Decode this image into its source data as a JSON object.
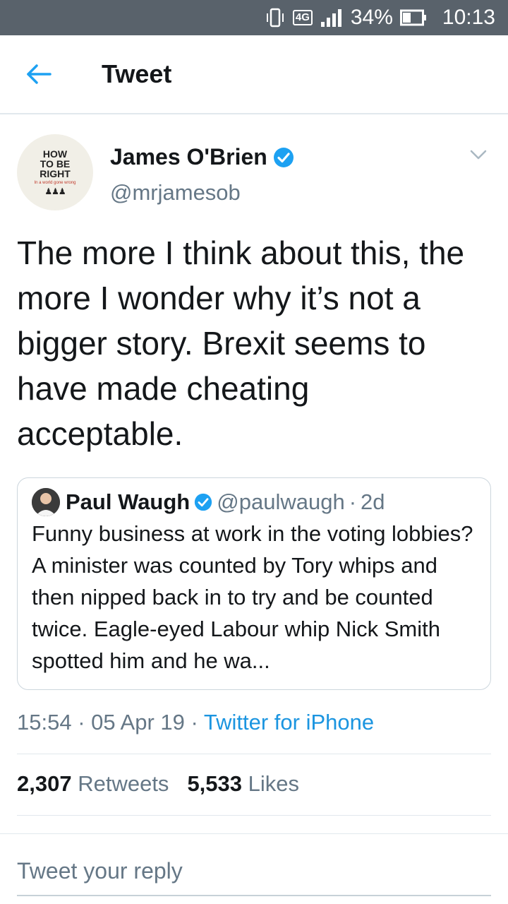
{
  "status_bar": {
    "network": "4G",
    "battery": "34%",
    "time": "10:13"
  },
  "header": {
    "title": "Tweet",
    "back_icon": "arrow-left-icon"
  },
  "tweet": {
    "avatar_text": [
      "HOW",
      "TO BE",
      "RIGHT",
      "In a world gone wrong"
    ],
    "display_name": "James O'Brien",
    "handle": "@mrjamesob",
    "text": "The more I think about this, the more I wonder why it’s not a bigger story. Brexit seems to have made cheating acceptable.",
    "quote": {
      "name": "Paul Waugh",
      "handle": "@paulwaugh",
      "separator": "·",
      "age": "2d",
      "text": "Funny business at work in the voting lobbies? A minister was counted by Tory whips and then nipped back in to try and be counted twice. Eagle-eyed Labour whip Nick Smith spotted him and he wa..."
    },
    "time": "15:54",
    "separator": "·",
    "date": "05 Apr 19",
    "source": "Twitter for iPhone",
    "retweets_count": "2,307",
    "retweets_label": "Retweets",
    "likes_count": "5,533",
    "likes_label": "Likes"
  },
  "reply": {
    "placeholder": "Tweet your reply"
  },
  "colors": {
    "accent": "#1da1f2",
    "status_bar": "#59626b",
    "muted": "#657786"
  }
}
